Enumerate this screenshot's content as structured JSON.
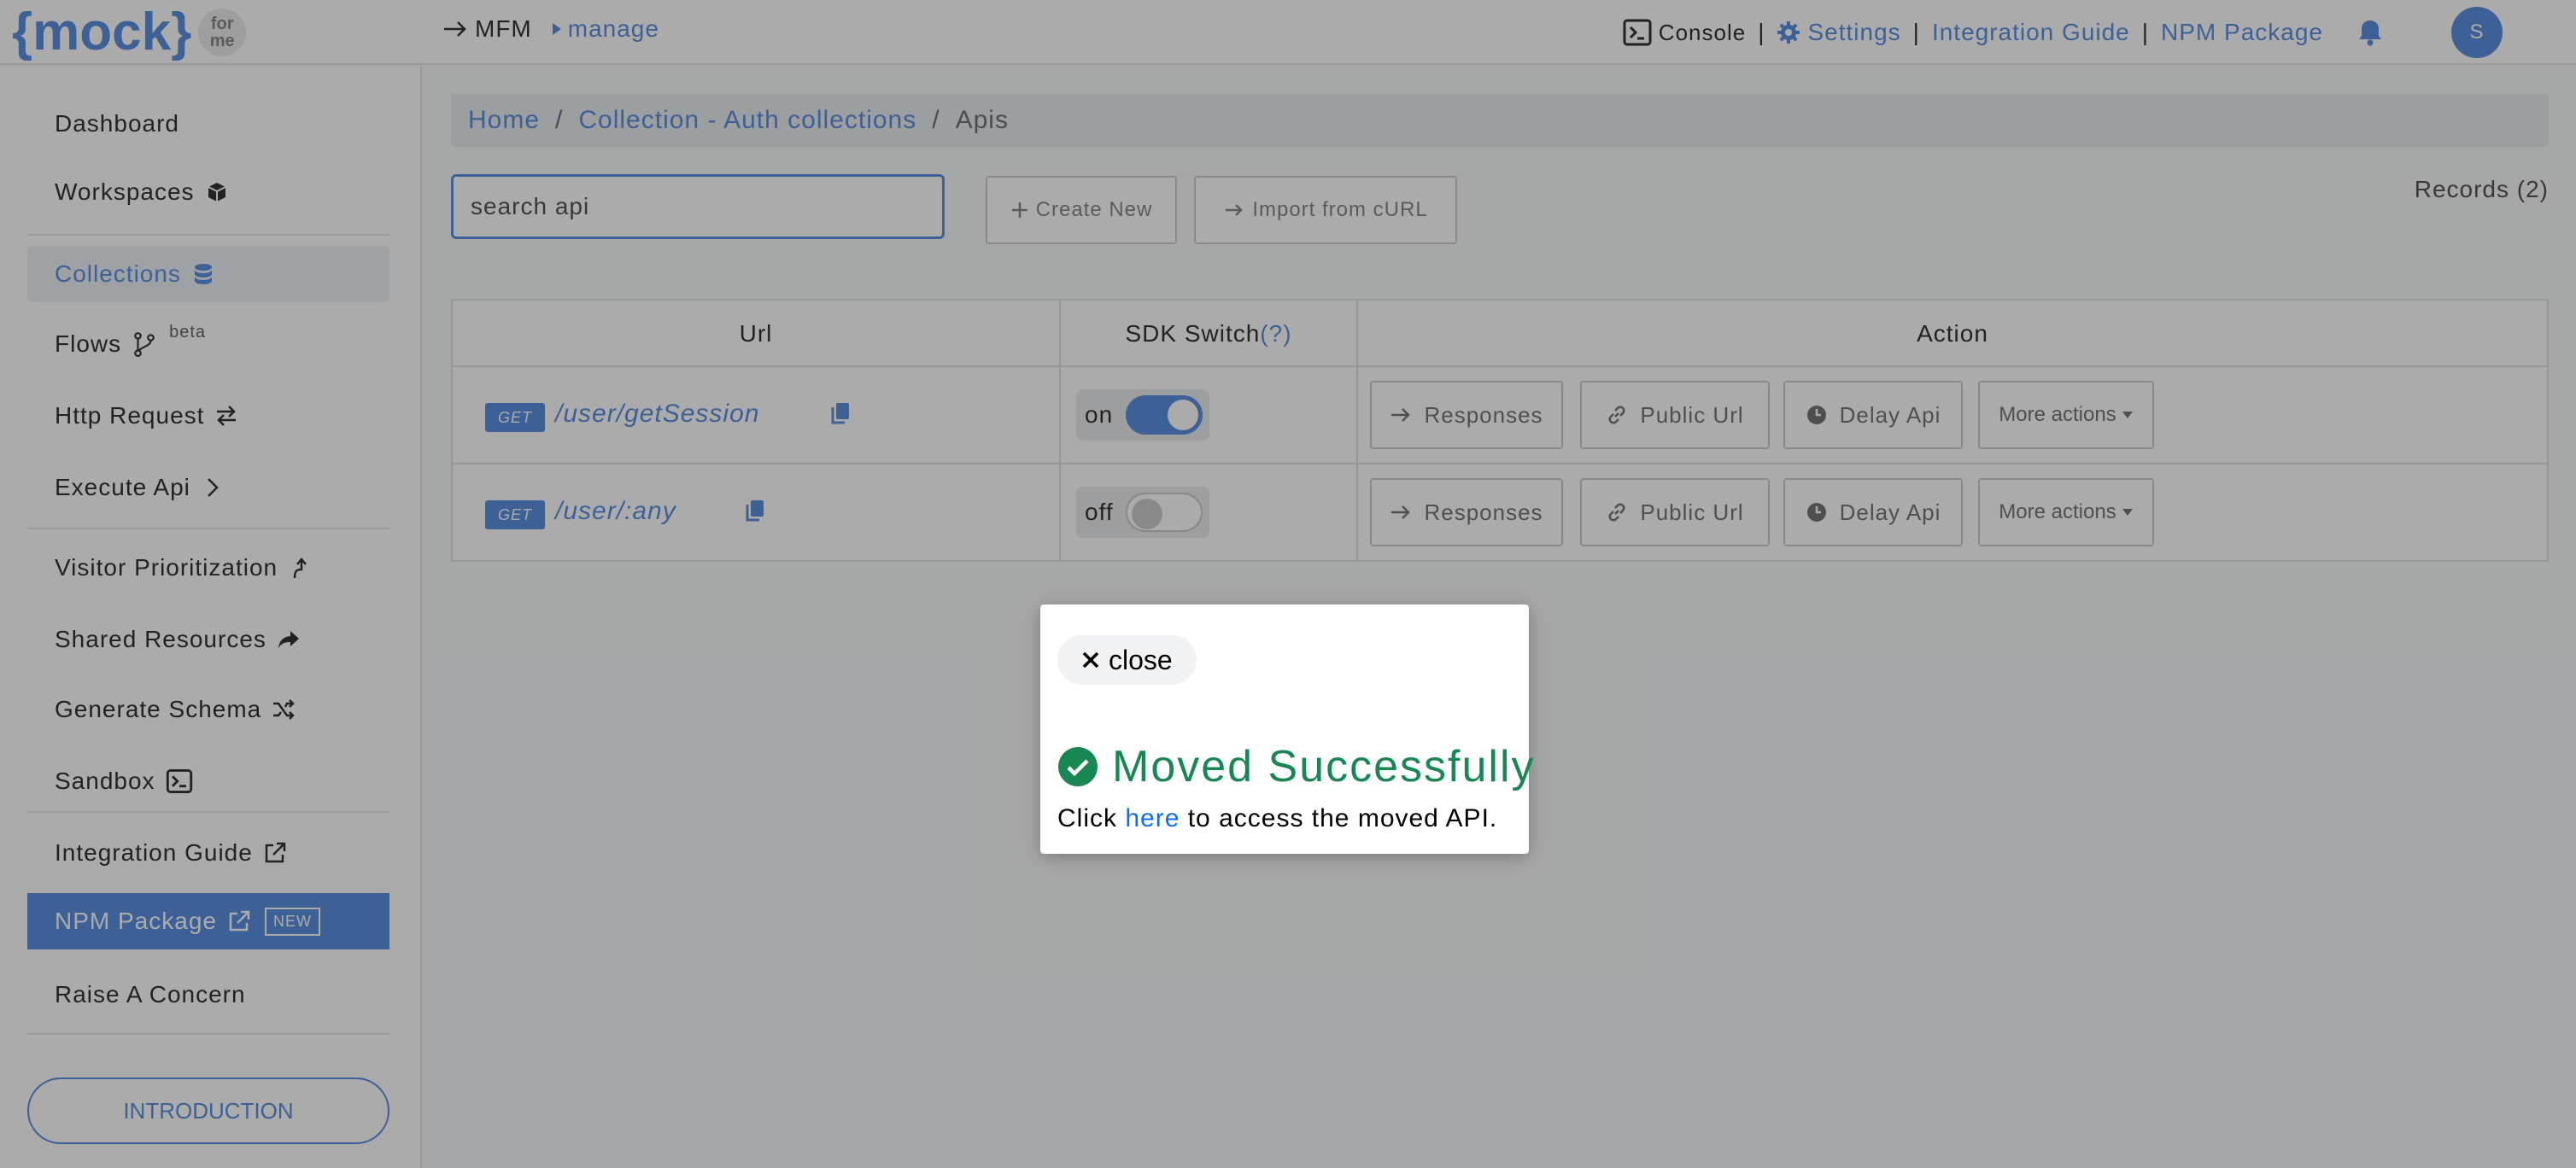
{
  "header": {
    "logo_text": "{mock}",
    "logo_badge_top": "for",
    "logo_badge_bottom": "me",
    "crumb_root": "MFM",
    "crumb_current": "manage",
    "console": "Console",
    "settings": "Settings",
    "integration_guide": "Integration Guide",
    "npm_package": "NPM Package",
    "separator": "|",
    "avatar_initial": "S"
  },
  "sidebar": {
    "dashboard": "Dashboard",
    "workspaces": "Workspaces",
    "collections": "Collections",
    "flows": "Flows",
    "flows_badge": "beta",
    "http_request": "Http Request",
    "execute_api": "Execute Api",
    "visitor_prioritization": "Visitor Prioritization",
    "shared_resources": "Shared Resources",
    "generate_schema": "Generate Schema",
    "sandbox": "Sandbox",
    "integration_guide": "Integration Guide",
    "npm_package": "NPM Package",
    "npm_badge": "NEW",
    "raise_concern": "Raise A Concern",
    "introduction": "INTRODUCTION"
  },
  "breadcrumb": {
    "home": "Home",
    "collection": "Collection - Auth collections",
    "current": "Apis",
    "sep": "/"
  },
  "toolbar": {
    "search_placeholder": "search api",
    "create_new": "Create New",
    "import_curl": "Import from cURL",
    "records": "Records (2)"
  },
  "table": {
    "col_url": "Url",
    "col_sdk": "SDK Switch",
    "col_sdk_help": "(?)",
    "col_action": "Action",
    "rows": [
      {
        "method": "GET",
        "path": "/user/getSession",
        "sdk_label": "on",
        "sdk_on": true
      },
      {
        "method": "GET",
        "path": "/user/:any",
        "sdk_label": "off",
        "sdk_on": false
      }
    ],
    "actions": {
      "responses": "Responses",
      "public_url": "Public Url",
      "delay_api": "Delay Api",
      "more_actions": "More actions"
    }
  },
  "modal": {
    "close": "close",
    "title": "Moved Successfully",
    "msg_before": "Click ",
    "msg_link": "here",
    "msg_after": " to access the moved API."
  },
  "colors": {
    "accent": "#5b8fe0",
    "success": "#198754",
    "link": "#0d6efd"
  }
}
